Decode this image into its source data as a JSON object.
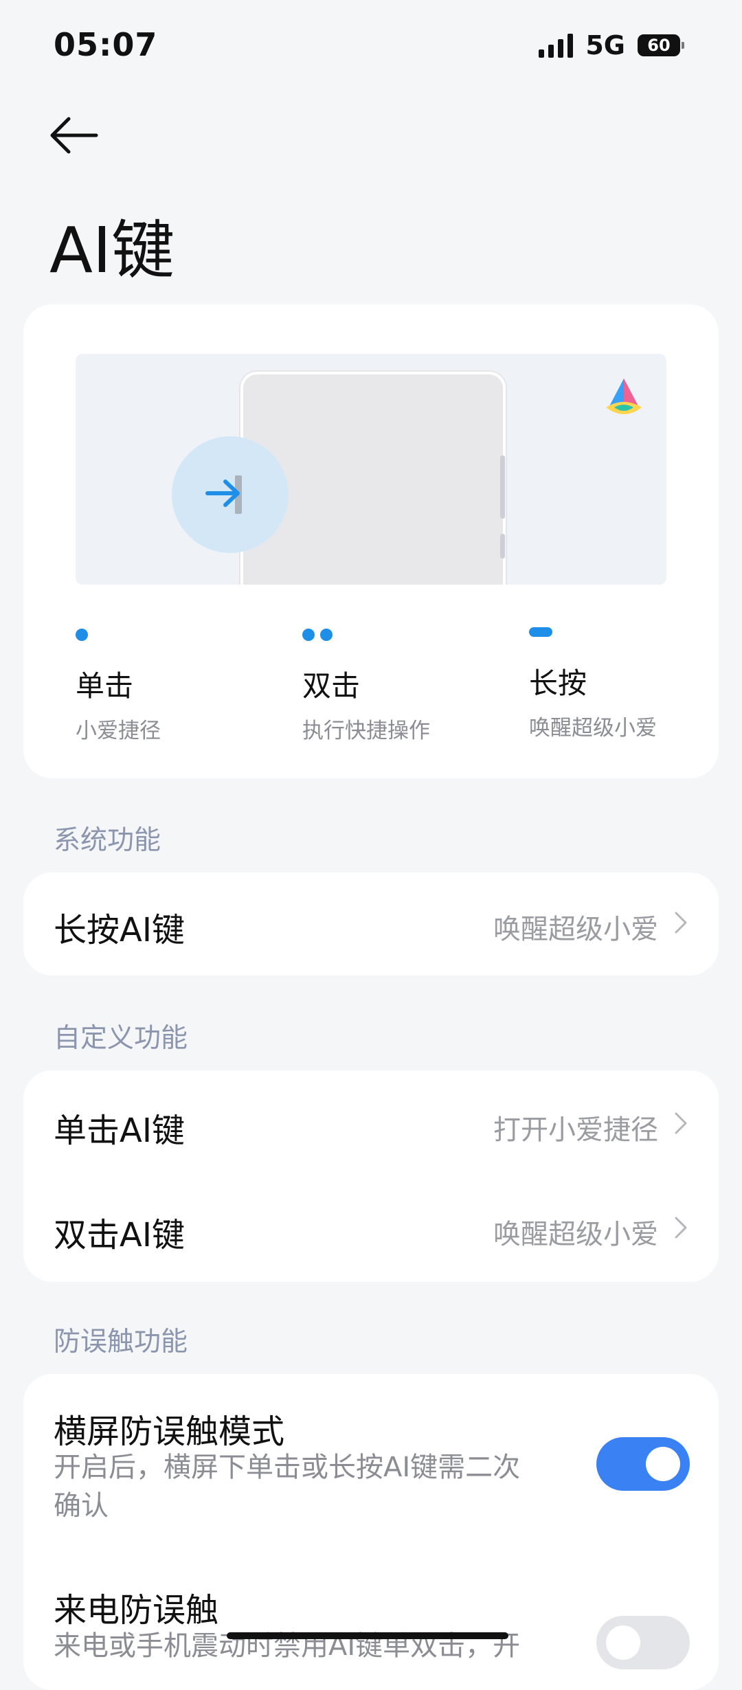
{
  "status": {
    "time": "05:07",
    "network": "5G",
    "battery": "60"
  },
  "page": {
    "title": "AI键"
  },
  "modes": [
    {
      "name": "单击",
      "desc": "小爱捷径"
    },
    {
      "name": "双击",
      "desc": "执行快捷操作"
    },
    {
      "name": "长按",
      "desc": "唤醒超级小爱"
    }
  ],
  "sections": {
    "system": {
      "title": "系统功能",
      "items": [
        {
          "label": "长按AI键",
          "value": "唤醒超级小爱"
        }
      ]
    },
    "custom": {
      "title": "自定义功能",
      "items": [
        {
          "label": "单击AI键",
          "value": "打开小爱捷径"
        },
        {
          "label": "双击AI键",
          "value": "唤醒超级小爱"
        }
      ]
    },
    "anti": {
      "title": "防误触功能",
      "items": [
        {
          "label": "横屏防误触模式",
          "desc_line1": "开启后，横屏下单击或长按AI键需二次",
          "desc_line2": "确认",
          "enabled": true
        },
        {
          "label": "来电防误触",
          "desc_line1": "来电或手机震动时禁用AI键单双击，开",
          "enabled": false
        }
      ]
    }
  },
  "colors": {
    "accent": "#3a81f4",
    "indicator": "#1e8fe8",
    "background": "#f5f6f8",
    "section_title": "#8b95ad"
  }
}
